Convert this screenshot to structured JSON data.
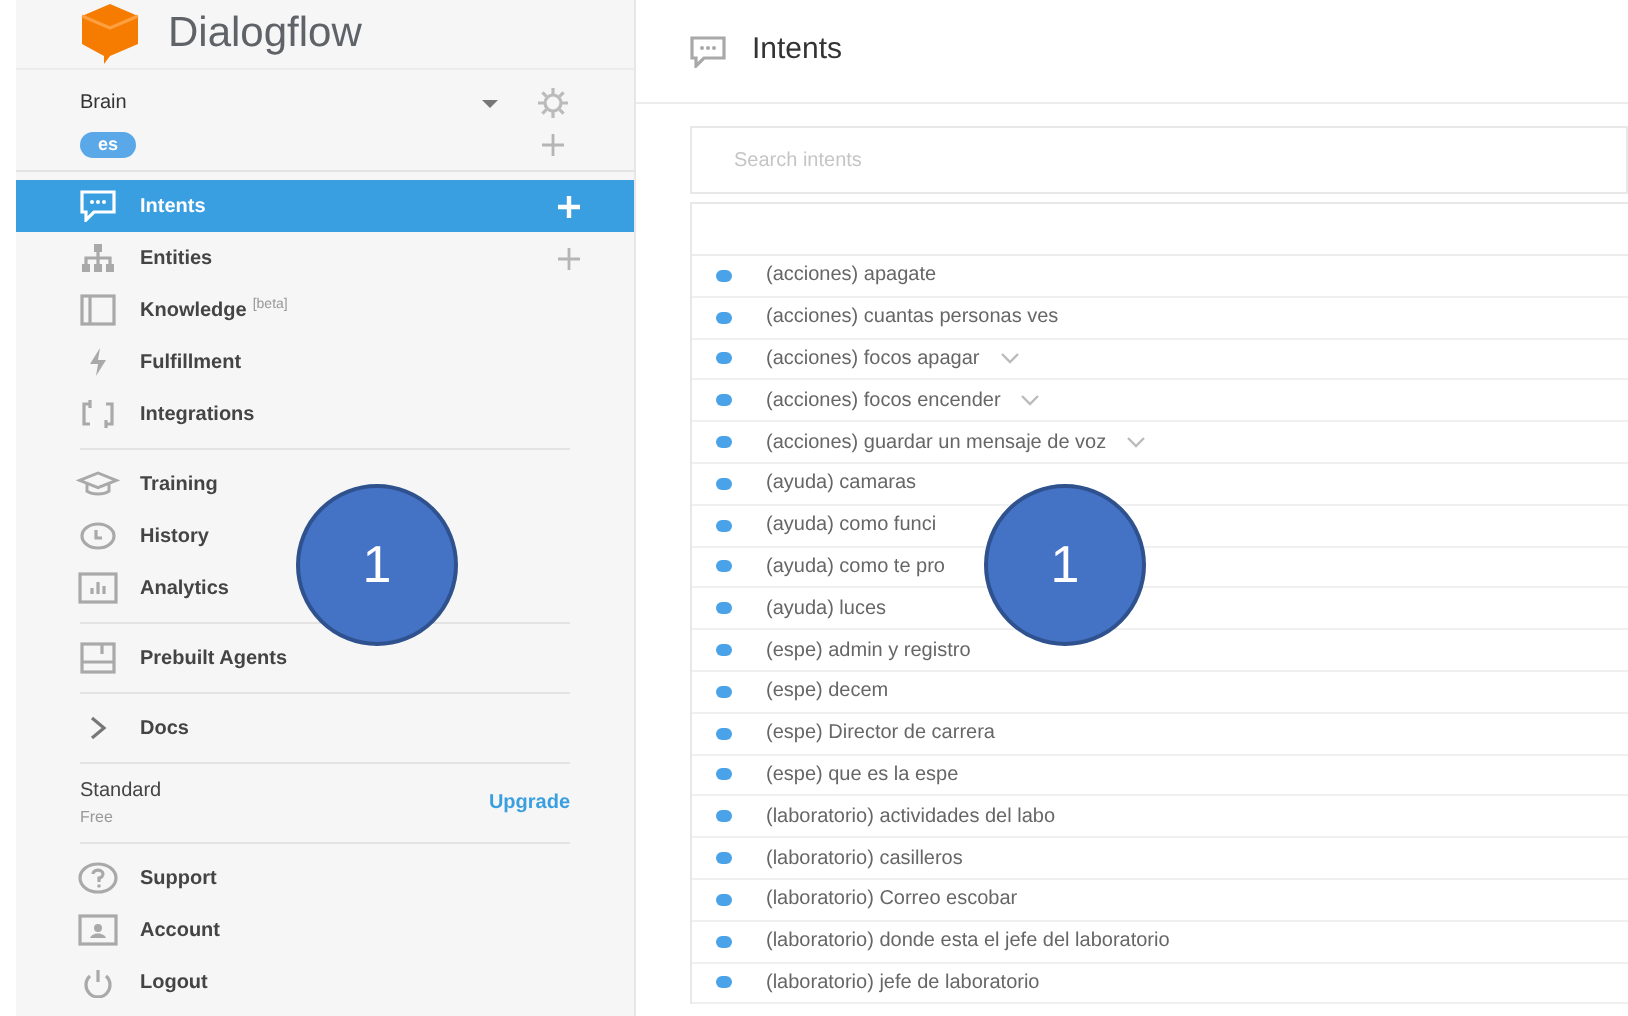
{
  "sidebar": {
    "logo": "Dialogflow",
    "agent": {
      "name": "Brain",
      "language": "es"
    },
    "groups": [
      [
        {
          "label": "Intents",
          "selected": true,
          "add": true
        },
        {
          "label": "Entities",
          "selected": false,
          "add": true
        },
        {
          "label": "Knowledge",
          "sup": "[beta]",
          "selected": false,
          "add": false
        },
        {
          "label": "Fulfillment",
          "selected": false,
          "add": false
        },
        {
          "label": "Integrations",
          "selected": false,
          "add": false
        }
      ],
      [
        {
          "label": "Training",
          "selected": false,
          "add": false
        },
        {
          "label": "History",
          "selected": false,
          "add": false
        },
        {
          "label": "Analytics",
          "selected": false,
          "add": false
        }
      ],
      [
        {
          "label": "Prebuilt Agents",
          "selected": false,
          "add": false
        }
      ],
      [
        {
          "label": "Docs",
          "selected": false,
          "add": false
        }
      ]
    ],
    "plan": {
      "name": "Standard",
      "tier": "Free",
      "action": "Upgrade"
    },
    "footer": [
      {
        "label": "Support"
      },
      {
        "label": "Account"
      },
      {
        "label": "Logout"
      }
    ]
  },
  "main": {
    "title": "Intents",
    "search": {
      "placeholder": "Search intents"
    },
    "intents": [
      {
        "name": "(acciones) apagate",
        "expandable": false
      },
      {
        "name": "(acciones) cuantas personas ves",
        "expandable": false
      },
      {
        "name": "(acciones) focos apagar",
        "expandable": true
      },
      {
        "name": "(acciones) focos encender",
        "expandable": true
      },
      {
        "name": "(acciones) guardar un mensaje de voz",
        "expandable": true
      },
      {
        "name": "(ayuda) camaras",
        "expandable": false
      },
      {
        "name": "(ayuda) como funci",
        "expandable": false
      },
      {
        "name": "(ayuda) como te pro",
        "expandable": false
      },
      {
        "name": "(ayuda) luces",
        "expandable": false
      },
      {
        "name": "(espe) admin y registro",
        "expandable": false
      },
      {
        "name": "(espe) decem",
        "expandable": false
      },
      {
        "name": "(espe) Director de carrera",
        "expandable": false
      },
      {
        "name": "(espe) que es la espe",
        "expandable": false
      },
      {
        "name": "(laboratorio) actividades del labo",
        "expandable": false
      },
      {
        "name": "(laboratorio) casilleros",
        "expandable": false
      },
      {
        "name": "(laboratorio) Correo escobar",
        "expandable": false
      },
      {
        "name": "(laboratorio) donde esta el jefe del laboratorio",
        "expandable": false
      },
      {
        "name": "(laboratorio) jefe de laboratorio",
        "expandable": false
      }
    ]
  },
  "markers": [
    {
      "label": "1"
    },
    {
      "label": "1"
    }
  ]
}
